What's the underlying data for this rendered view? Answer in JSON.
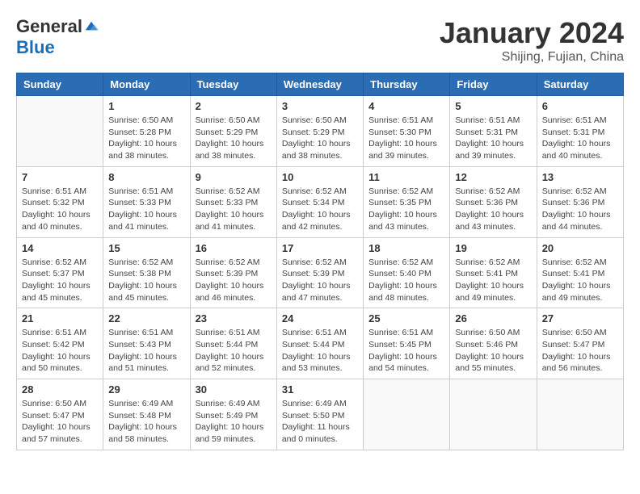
{
  "header": {
    "logo_general": "General",
    "logo_blue": "Blue",
    "title": "January 2024",
    "subtitle": "Shijing, Fujian, China"
  },
  "calendar": {
    "days_of_week": [
      "Sunday",
      "Monday",
      "Tuesday",
      "Wednesday",
      "Thursday",
      "Friday",
      "Saturday"
    ],
    "weeks": [
      [
        {
          "day": "",
          "info": ""
        },
        {
          "day": "1",
          "info": "Sunrise: 6:50 AM\nSunset: 5:28 PM\nDaylight: 10 hours\nand 38 minutes."
        },
        {
          "day": "2",
          "info": "Sunrise: 6:50 AM\nSunset: 5:29 PM\nDaylight: 10 hours\nand 38 minutes."
        },
        {
          "day": "3",
          "info": "Sunrise: 6:50 AM\nSunset: 5:29 PM\nDaylight: 10 hours\nand 38 minutes."
        },
        {
          "day": "4",
          "info": "Sunrise: 6:51 AM\nSunset: 5:30 PM\nDaylight: 10 hours\nand 39 minutes."
        },
        {
          "day": "5",
          "info": "Sunrise: 6:51 AM\nSunset: 5:31 PM\nDaylight: 10 hours\nand 39 minutes."
        },
        {
          "day": "6",
          "info": "Sunrise: 6:51 AM\nSunset: 5:31 PM\nDaylight: 10 hours\nand 40 minutes."
        }
      ],
      [
        {
          "day": "7",
          "info": "Sunrise: 6:51 AM\nSunset: 5:32 PM\nDaylight: 10 hours\nand 40 minutes."
        },
        {
          "day": "8",
          "info": "Sunrise: 6:51 AM\nSunset: 5:33 PM\nDaylight: 10 hours\nand 41 minutes."
        },
        {
          "day": "9",
          "info": "Sunrise: 6:52 AM\nSunset: 5:33 PM\nDaylight: 10 hours\nand 41 minutes."
        },
        {
          "day": "10",
          "info": "Sunrise: 6:52 AM\nSunset: 5:34 PM\nDaylight: 10 hours\nand 42 minutes."
        },
        {
          "day": "11",
          "info": "Sunrise: 6:52 AM\nSunset: 5:35 PM\nDaylight: 10 hours\nand 43 minutes."
        },
        {
          "day": "12",
          "info": "Sunrise: 6:52 AM\nSunset: 5:36 PM\nDaylight: 10 hours\nand 43 minutes."
        },
        {
          "day": "13",
          "info": "Sunrise: 6:52 AM\nSunset: 5:36 PM\nDaylight: 10 hours\nand 44 minutes."
        }
      ],
      [
        {
          "day": "14",
          "info": "Sunrise: 6:52 AM\nSunset: 5:37 PM\nDaylight: 10 hours\nand 45 minutes."
        },
        {
          "day": "15",
          "info": "Sunrise: 6:52 AM\nSunset: 5:38 PM\nDaylight: 10 hours\nand 45 minutes."
        },
        {
          "day": "16",
          "info": "Sunrise: 6:52 AM\nSunset: 5:39 PM\nDaylight: 10 hours\nand 46 minutes."
        },
        {
          "day": "17",
          "info": "Sunrise: 6:52 AM\nSunset: 5:39 PM\nDaylight: 10 hours\nand 47 minutes."
        },
        {
          "day": "18",
          "info": "Sunrise: 6:52 AM\nSunset: 5:40 PM\nDaylight: 10 hours\nand 48 minutes."
        },
        {
          "day": "19",
          "info": "Sunrise: 6:52 AM\nSunset: 5:41 PM\nDaylight: 10 hours\nand 49 minutes."
        },
        {
          "day": "20",
          "info": "Sunrise: 6:52 AM\nSunset: 5:41 PM\nDaylight: 10 hours\nand 49 minutes."
        }
      ],
      [
        {
          "day": "21",
          "info": "Sunrise: 6:51 AM\nSunset: 5:42 PM\nDaylight: 10 hours\nand 50 minutes."
        },
        {
          "day": "22",
          "info": "Sunrise: 6:51 AM\nSunset: 5:43 PM\nDaylight: 10 hours\nand 51 minutes."
        },
        {
          "day": "23",
          "info": "Sunrise: 6:51 AM\nSunset: 5:44 PM\nDaylight: 10 hours\nand 52 minutes."
        },
        {
          "day": "24",
          "info": "Sunrise: 6:51 AM\nSunset: 5:44 PM\nDaylight: 10 hours\nand 53 minutes."
        },
        {
          "day": "25",
          "info": "Sunrise: 6:51 AM\nSunset: 5:45 PM\nDaylight: 10 hours\nand 54 minutes."
        },
        {
          "day": "26",
          "info": "Sunrise: 6:50 AM\nSunset: 5:46 PM\nDaylight: 10 hours\nand 55 minutes."
        },
        {
          "day": "27",
          "info": "Sunrise: 6:50 AM\nSunset: 5:47 PM\nDaylight: 10 hours\nand 56 minutes."
        }
      ],
      [
        {
          "day": "28",
          "info": "Sunrise: 6:50 AM\nSunset: 5:47 PM\nDaylight: 10 hours\nand 57 minutes."
        },
        {
          "day": "29",
          "info": "Sunrise: 6:49 AM\nSunset: 5:48 PM\nDaylight: 10 hours\nand 58 minutes."
        },
        {
          "day": "30",
          "info": "Sunrise: 6:49 AM\nSunset: 5:49 PM\nDaylight: 10 hours\nand 59 minutes."
        },
        {
          "day": "31",
          "info": "Sunrise: 6:49 AM\nSunset: 5:50 PM\nDaylight: 11 hours\nand 0 minutes."
        },
        {
          "day": "",
          "info": ""
        },
        {
          "day": "",
          "info": ""
        },
        {
          "day": "",
          "info": ""
        }
      ]
    ]
  }
}
